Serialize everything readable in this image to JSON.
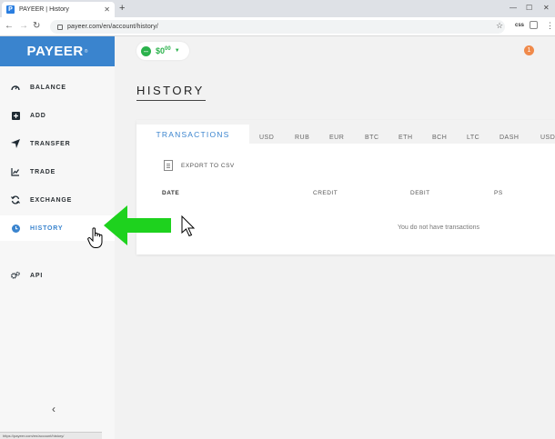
{
  "browser": {
    "tab_title": "PAYEER | History",
    "favicon_letter": "P",
    "url": "payeer.com/en/account/history/",
    "ext_label": "css"
  },
  "sidebar": {
    "logo": "PAYEER",
    "logo_mark": "®",
    "items": [
      {
        "label": "BALANCE",
        "icon": "gauge-icon"
      },
      {
        "label": "ADD",
        "icon": "plus-square-icon"
      },
      {
        "label": "TRANSFER",
        "icon": "send-icon"
      },
      {
        "label": "TRADE",
        "icon": "chart-icon"
      },
      {
        "label": "EXCHANGE",
        "icon": "exchange-icon"
      },
      {
        "label": "HISTORY",
        "icon": "clock-icon",
        "active": true
      },
      {
        "label": "API",
        "icon": "gears-icon"
      }
    ],
    "collapse_glyph": "‹"
  },
  "header": {
    "balance": "$0",
    "balance_cents": "00",
    "notifications": "1"
  },
  "page": {
    "title": "HISTORY",
    "tabs": [
      "TRANSACTIONS",
      "USD",
      "RUB",
      "EUR",
      "BTC",
      "ETH",
      "BCH",
      "LTC",
      "DASH",
      "USDT"
    ],
    "export_label": "EXPORT TO CSV",
    "columns": [
      "DATE",
      "CREDIT",
      "DEBIT",
      "PS"
    ],
    "empty_message": "You do not have transactions"
  },
  "statusbar": {
    "text": "https://payeer.com/en/account/history/"
  },
  "colors": {
    "brand": "#3a84ce",
    "balance": "#2bb24c",
    "annotation_arrow": "#1ed21e",
    "notification": "#f08a4b"
  }
}
